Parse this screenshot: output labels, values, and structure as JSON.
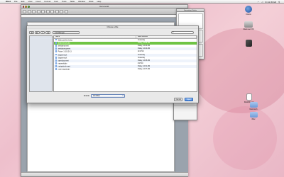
{
  "menubar": {
    "apple": "",
    "items": [
      "Word",
      "File",
      "Edit",
      "View",
      "Insert",
      "Format",
      "Font",
      "Tools",
      "Table",
      "Window",
      "Work",
      "Help"
    ],
    "clock": "Fri 11:45 AM"
  },
  "document_window": {
    "title": "Document1"
  },
  "toolbox_window": {
    "title": "Formatting Palette"
  },
  "dialog": {
    "title": "Choose a File",
    "location": "mondhamger",
    "search_placeholder": "",
    "columns": {
      "name": "Name",
      "date": "Date Modified"
    },
    "files": [
      {
        "name": "Whitmore01_01.doc",
        "date": "Yesterday"
      },
      {
        "name": "Searchresult.doc",
        "date": "Friday, 12:59 AM",
        "selected": true
      },
      {
        "name": "armidamyment",
        "date": "Friday, 12:44 AM"
      },
      {
        "name": "armidaomypment",
        "date": "Friday, 12:44 AM"
      },
      {
        "name": "Picture 1-15-15-13",
        "date": "11/17/10"
      },
      {
        "name": "degamerock",
        "date": "Yesterday"
      },
      {
        "name": "degamerock",
        "date": "Yesterday"
      },
      {
        "name": "opendocument",
        "date": "Friday, 12:45 AM"
      },
      {
        "name": "naewerktiole",
        "date": "4/17/10"
      },
      {
        "name": "navigationlemant",
        "date": "Friday, 12:31 AM"
      },
      {
        "name": "roarmergeateoje",
        "date": "Friday, 12:37 AM"
      }
    ],
    "enable_label": "Enable:",
    "enable_value": "All Office",
    "cancel": "Cancel",
    "open": "Open"
  },
  "desktop_icons": [
    {
      "label": "Firefox"
    },
    {
      "label": "Macintosh HD"
    },
    {
      "label": ""
    },
    {
      "label": "RackWiz.xlsx"
    },
    {
      "label": "Macintosh"
    },
    {
      "label": "iMac"
    }
  ],
  "colors": {
    "selection": "#6fc445",
    "accent": "#3e84e3"
  }
}
